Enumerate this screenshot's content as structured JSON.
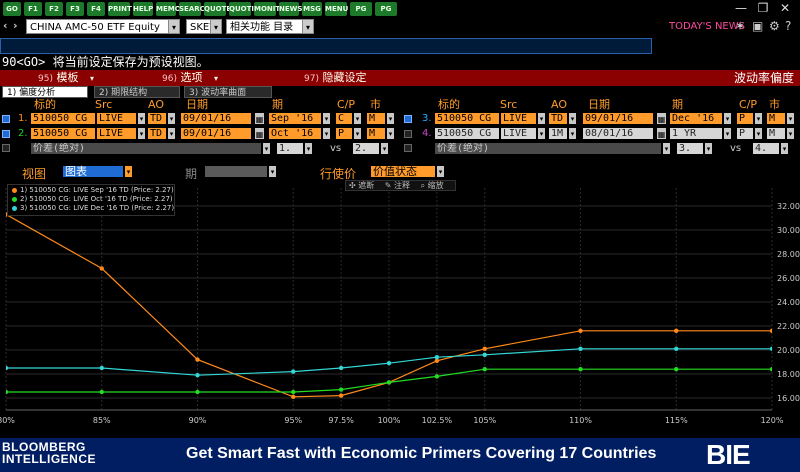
{
  "fkeys": [
    "GO",
    "F1",
    "F2",
    "F3",
    "F4",
    "PRINT",
    "HELP",
    "MEMO",
    "SEARC",
    "QUOTE",
    "QUOTI",
    "MONIT",
    "NEWS",
    "MSG",
    "MENU",
    "PG BA",
    "PG FW"
  ],
  "window_controls": {
    "minimize": "—",
    "restore": "❐",
    "close": "✕"
  },
  "security": {
    "ticker": "CHINA AMC-50 ETF Equity",
    "function": "SKEW",
    "related": "相关功能  目录",
    "news_badge": "TODAY'S NEWS"
  },
  "command_line": {
    "value": ""
  },
  "help_line": "90<GO> 将当前设定保存为预设视图。",
  "menu": {
    "items": [
      {
        "num": "95)",
        "label": "模板"
      },
      {
        "num": "96)",
        "label": "选项"
      },
      {
        "num": "97)",
        "label": "隐藏设定"
      }
    ],
    "title": "波动率偏度"
  },
  "tabs": [
    {
      "label": "1) 偏度分析",
      "active": true
    },
    {
      "label": "2) 期限结构",
      "active": false
    },
    {
      "label": "3) 波动率曲面",
      "active": false
    }
  ],
  "params": {
    "headers": {
      "ticker": "标的",
      "src": "Src",
      "ao": "AO",
      "date": "日期",
      "term": "期",
      "cp": "C/P",
      "market": "市"
    },
    "left_rows": [
      {
        "num": "1.",
        "ticker": "510050 CG",
        "src": "LIVE",
        "ao": "TD",
        "date": "09/01/16",
        "term": "Sep '16",
        "cp": "C",
        "market": "M",
        "color": "#ff8a1a",
        "checked": true
      },
      {
        "num": "2.",
        "ticker": "510050 CG",
        "src": "LIVE",
        "ao": "TD",
        "date": "09/01/16",
        "term": "Oct '16",
        "cp": "P",
        "market": "M",
        "color": "#22cc22",
        "checked": true
      }
    ],
    "left_compare": {
      "label": "价差(绝对)",
      "a": "1.",
      "vs": "vs",
      "b": "2."
    },
    "right_rows": [
      {
        "num": "3.",
        "ticker": "510050 CG",
        "src": "LIVE",
        "ao": "TD",
        "date": "09/01/16",
        "term": "Dec '16",
        "cp": "P",
        "market": "M",
        "color": "#22aaff",
        "checked": true
      },
      {
        "num": "4.",
        "ticker": "510050 CG",
        "src": "LIVE",
        "ao": "1M",
        "date": "08/01/16",
        "term": "1 YR",
        "cp": "P",
        "market": "M",
        "color": "#cc44cc",
        "checked": false
      }
    ],
    "right_compare": {
      "label": "价差(绝对)",
      "a": "3.",
      "vs": "vs",
      "b": "4."
    }
  },
  "view": {
    "view_label": "视图",
    "view_value": "图表",
    "term_label": "期",
    "term_value": "",
    "strike_label": "行使价",
    "strike_value": "价值状态"
  },
  "chart_toolbar": [
    "✣ 遮断",
    "✎ 注释",
    "⌕ 缩放"
  ],
  "chart_data": {
    "type": "line",
    "x": [
      "80%",
      "85%",
      "90%",
      "95%",
      "97.5%",
      "100%",
      "102.5%",
      "105%",
      "110%",
      "115%",
      "120%"
    ],
    "x_numeric": [
      80,
      85,
      90,
      95,
      97.5,
      100,
      102.5,
      105,
      110,
      115,
      120
    ],
    "y_ticks": [
      16.0,
      18.0,
      20.0,
      22.0,
      24.0,
      26.0,
      28.0,
      30.0,
      32.0
    ],
    "ylim": [
      15,
      33.5
    ],
    "xlim": [
      80,
      120
    ],
    "grid": true,
    "legend_position": "top-left",
    "series": [
      {
        "name": "1) 510050 CG: LIVE Sep '16 TD (Price: 2.27)",
        "color": "#ff8a1a",
        "values": [
          31.3,
          26.8,
          19.2,
          16.1,
          16.2,
          17.3,
          19.1,
          20.1,
          21.6,
          21.6,
          21.6
        ]
      },
      {
        "name": "2) 510050 CG: LIVE Oct '16 TD (Price: 2.27)",
        "color": "#22dd22",
        "values": [
          16.5,
          16.5,
          16.5,
          16.5,
          16.7,
          17.3,
          17.8,
          18.4,
          18.4,
          18.4,
          18.4
        ]
      },
      {
        "name": "3) 510050 CG: LIVE Dec '16 TD (Price: 2.27)",
        "color": "#33d6d6",
        "values": [
          18.5,
          18.5,
          17.9,
          18.2,
          18.5,
          18.9,
          19.4,
          19.6,
          20.1,
          20.1,
          20.1
        ]
      }
    ]
  },
  "banner": {
    "logo_line1": "BLOOMBERG",
    "logo_line2": "INTELLIGENCE",
    "text": "Get Smart Fast with Economic Primers Covering 17 Countries",
    "brand": "BIE"
  }
}
